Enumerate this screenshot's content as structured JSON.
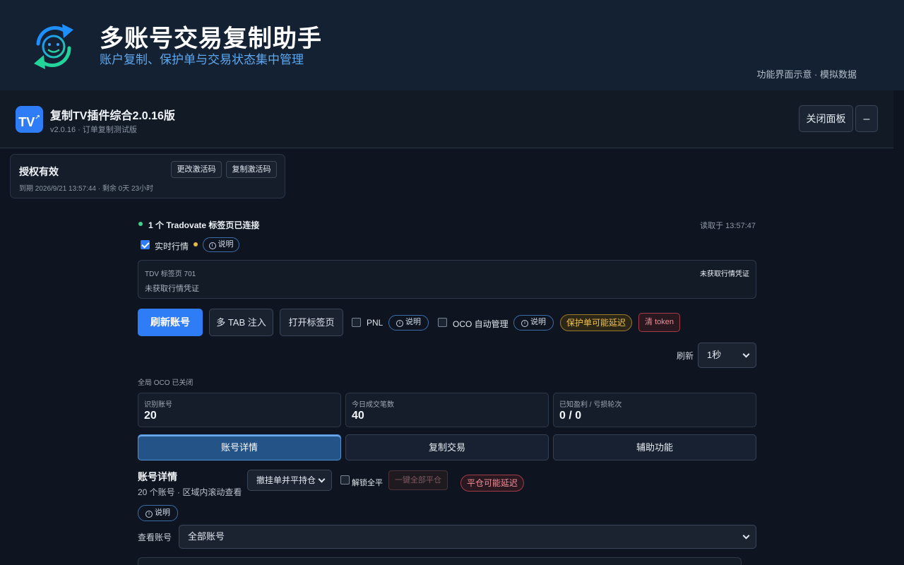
{
  "banner": {
    "title": "多账号交易复制助手",
    "subtitle": "账户复制、保护单与交易状态集中管理",
    "note": "功能界面示意 · 模拟数据"
  },
  "panel": {
    "icon_text": "TV",
    "title": "复制TV插件综合2.0.16版",
    "version": "v2.0.16 · 订单复制测试版",
    "close_label": "关闭面板",
    "minimize_label": "–"
  },
  "license": {
    "status": "授权有效",
    "expiry": "到期 2026/9/21 13:57:44 · 剩余 0天 23小时",
    "change_label": "更改激活码",
    "copy_label": "复制激活码"
  },
  "connection": {
    "status": "1 个 Tradovate 标签页已连接",
    "read_time": "读取于 13:57:47",
    "realtime_label": "实时行情",
    "realtime_checked": true,
    "info_label": "说明"
  },
  "tdv": {
    "tab_label": "TDV 标签页 701",
    "right_status": "未获取行情凭证",
    "message": "未获取行情凭证"
  },
  "actions": {
    "refresh_accounts": "刷新账号",
    "multi_tab_inject": "多 TAB 注入",
    "open_tab": "打开标签页",
    "pnl_label": "PNL",
    "pnl_info": "说明",
    "oco_label": "OCO 自动管理",
    "oco_info": "说明",
    "protect_badge": "保护单可能延迟",
    "clear_token": "清 token"
  },
  "refresh": {
    "label": "刷新",
    "value": "1秒"
  },
  "oco_status": "全局 OCO 已关闭",
  "stats": [
    {
      "label": "识别账号",
      "value": "20"
    },
    {
      "label": "今日成交笔数",
      "value": "40"
    },
    {
      "label": "已知盈利 / 亏损轮次",
      "value": "0 / 0"
    }
  ],
  "tabs": [
    {
      "label": "账号详情",
      "active": true
    },
    {
      "label": "复制交易",
      "active": false
    },
    {
      "label": "辅助功能",
      "active": false
    }
  ],
  "account_section": {
    "title": "账号详情",
    "subtitle": "20 个账号 · 区域内滚动查看",
    "cancel_select": "撤挂单并平持仓",
    "unlock_label": "解锁全平",
    "close_all": "一键全部平仓",
    "close_delay_badge": "平仓可能延迟",
    "info_label": "说明",
    "view_label": "查看账号",
    "view_value": "全部账号"
  },
  "colors": {
    "accent": "#2f7df6",
    "success": "#3fcf8e",
    "warning": "#f0c24e",
    "danger": "#f08d98",
    "background": "#0f1520"
  }
}
